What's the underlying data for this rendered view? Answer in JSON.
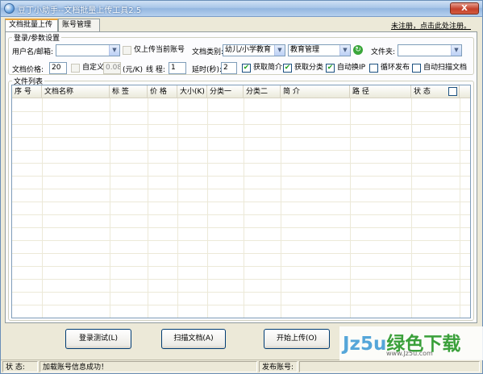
{
  "window": {
    "title": "豆丁小助手--文档批量上传工具2.5",
    "close_label": "X"
  },
  "tabs": [
    {
      "label": "文档批量上传",
      "active": true
    },
    {
      "label": "账号管理",
      "active": false
    }
  ],
  "register_link": "未注册，点击此处注册。",
  "login_group": {
    "legend": "登录/参数设置",
    "username_label": "用户名/邮箱:",
    "username_value": "",
    "only_current_label": "仅上传当前账号",
    "doc_category_label": "文档类别:",
    "category1_value": "幼儿/小学教育",
    "category2_value": "教育管理",
    "folder_label": "文件夹:",
    "folder_value": "",
    "price_label": "文档价格:",
    "price_value": "20",
    "custom_label": "自定义",
    "custom_value": "0.08",
    "unit_label": "(元/K)",
    "threads_label": "线  程:",
    "threads_value": "1",
    "delay_label": "延时(秒):",
    "delay_value": "2",
    "checkboxes": [
      {
        "label": "获取简介",
        "checked": true
      },
      {
        "label": "获取分类",
        "checked": true
      },
      {
        "label": "自动换IP",
        "checked": true
      },
      {
        "label": "循环发布",
        "checked": false
      },
      {
        "label": "自动扫描文档",
        "checked": false
      }
    ]
  },
  "file_list": {
    "legend": "文件列表",
    "columns": [
      "序  号",
      "文档名称",
      "标  签",
      "价  格",
      "大小(K)",
      "分类一",
      "分类二",
      "简    介",
      "路    径",
      "状  态"
    ]
  },
  "buttons": {
    "login_test": "登录测试(L)",
    "scan_docs": "扫描文档(A)",
    "start_upload": "开始上传(O)"
  },
  "statusbar": {
    "status_label": "状    态:",
    "status_text": "加载账号信息成功！",
    "publish_label": "发布账号:",
    "publish_value": ""
  },
  "watermark": {
    "brand_part1": "Jz5u",
    "brand_part2": "绿色下载",
    "url": "www.Jz5u.com"
  }
}
